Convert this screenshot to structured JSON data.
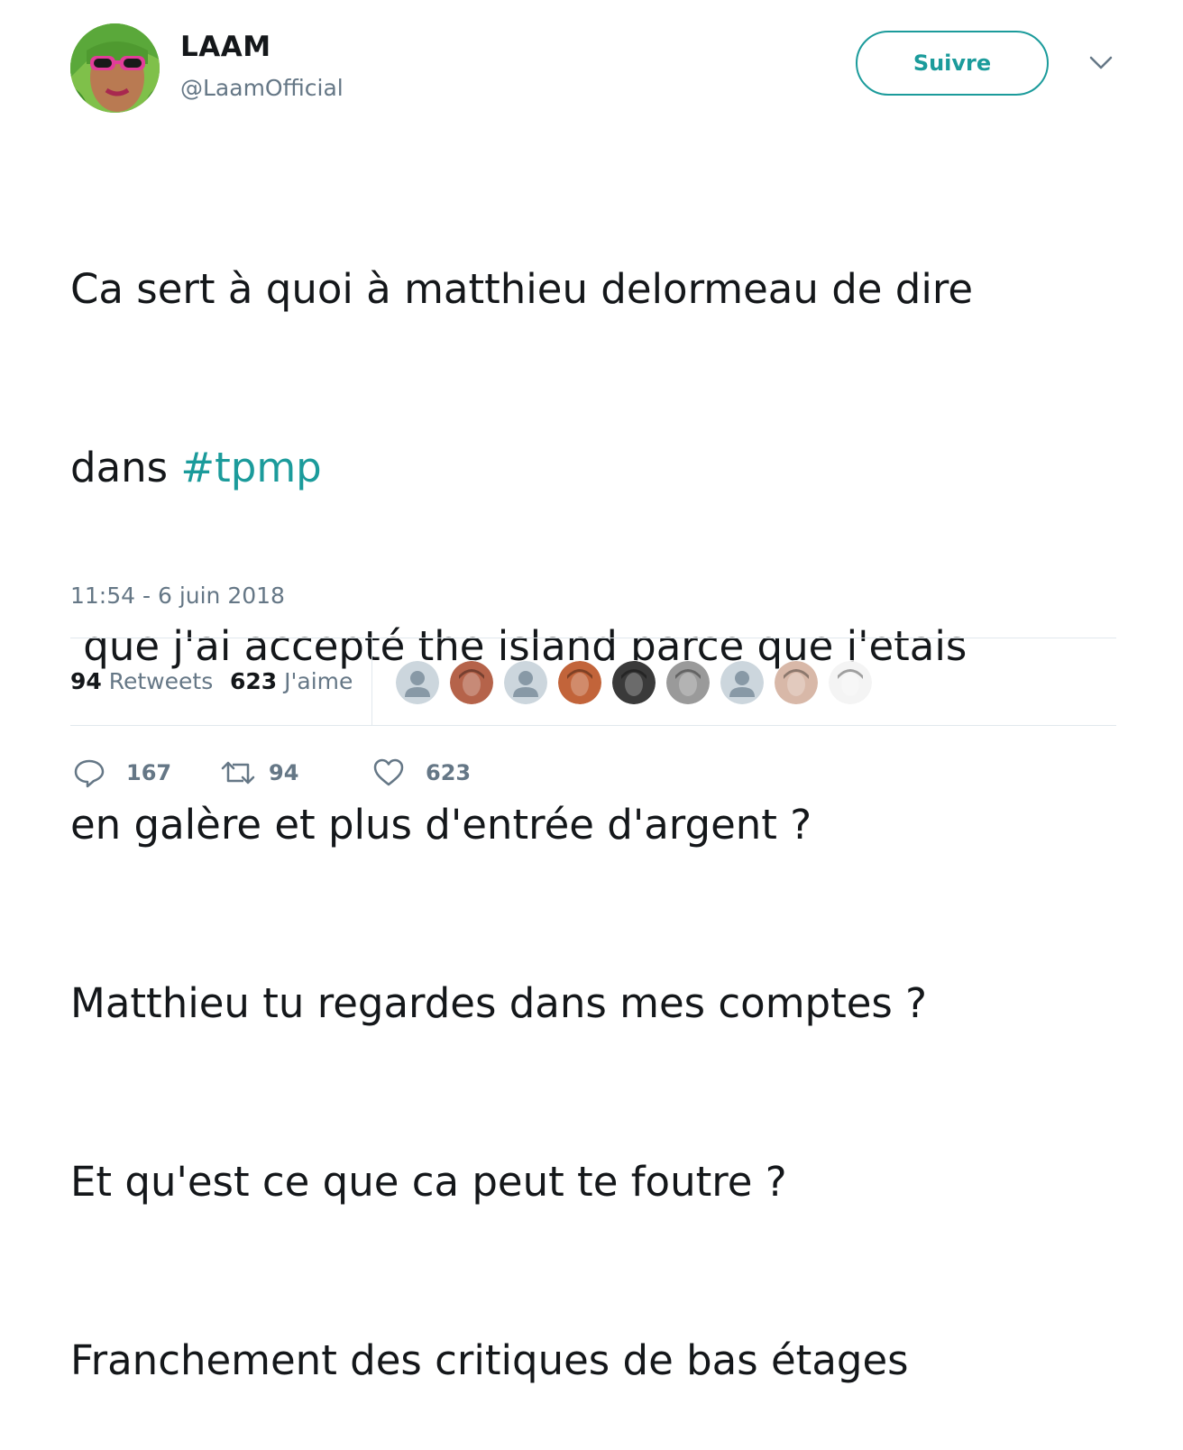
{
  "author": {
    "name": "LAAM",
    "handle": "@LaamOfficial"
  },
  "follow_button": {
    "label": "Suivre"
  },
  "tweet": {
    "lines": [
      {
        "before": "Ca sert à quoi à matthieu delormeau de dire",
        "hashtag": "",
        "after": ""
      },
      {
        "before": "dans ",
        "hashtag": "#tpmp",
        "after": ""
      },
      {
        "before": " que j'ai accepté the island parce que j'etais",
        "hashtag": "",
        "after": ""
      },
      {
        "before": "en galère et plus d'entrée d'argent ?",
        "hashtag": "",
        "after": ""
      },
      {
        "before": "Matthieu tu regardes dans mes comptes ?",
        "hashtag": "",
        "after": ""
      },
      {
        "before": "Et qu'est ce que ca peut te foutre ?",
        "hashtag": "",
        "after": ""
      },
      {
        "before": "Franchement des critiques de bas étages",
        "hashtag": "",
        "after": ""
      }
    ],
    "timestamp": "11:54 - 6 juin 2018"
  },
  "stats": {
    "retweets_count": "94",
    "retweets_label": "Retweets",
    "likes_count": "623",
    "likes_label": "J'aime"
  },
  "likers": [
    {
      "kind": "default-avatar",
      "color": "#ccd6dd"
    },
    {
      "kind": "photo-avatar",
      "color": "#b5634a"
    },
    {
      "kind": "default-avatar",
      "color": "#ccd6dd"
    },
    {
      "kind": "photo-avatar",
      "color": "#c2643a"
    },
    {
      "kind": "photo-avatar",
      "color": "#3a3a3a"
    },
    {
      "kind": "photo-avatar",
      "color": "#9a9a9a"
    },
    {
      "kind": "default-avatar",
      "color": "#ccd6dd"
    },
    {
      "kind": "photo-avatar",
      "color": "#d8b8a8"
    },
    {
      "kind": "photo-avatar",
      "color": "#f4f4f4"
    }
  ],
  "actions": {
    "reply_count": "167",
    "retweet_count": "94",
    "like_count": "623"
  },
  "colors": {
    "accent": "#1b9b9b",
    "secondary_text": "#657786",
    "divider": "#e1e8ed"
  }
}
